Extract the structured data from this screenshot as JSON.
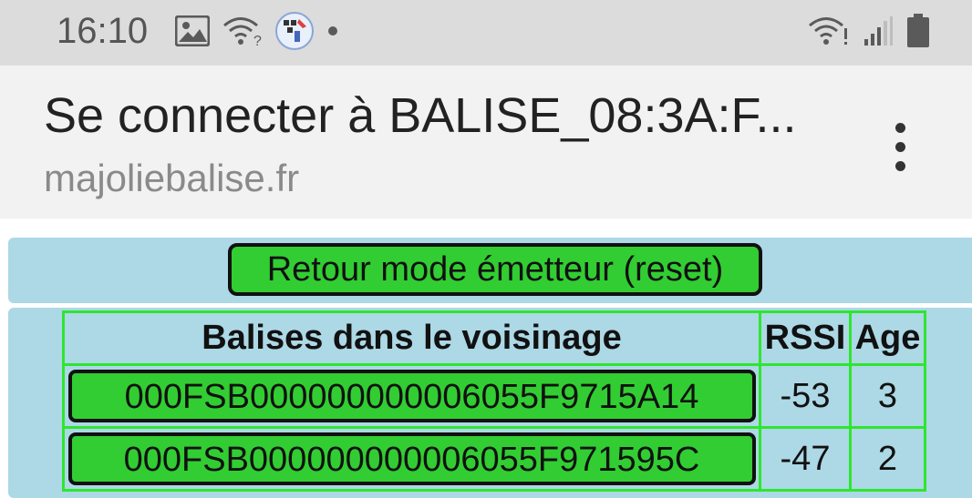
{
  "status_bar": {
    "time": "16:10",
    "left_icons": [
      "image-icon",
      "wifi-question-icon",
      "app-icon",
      "dot-icon"
    ],
    "right_icons": [
      "wifi-alert-icon",
      "signal-icon",
      "battery-icon"
    ]
  },
  "header": {
    "title": "Se connecter à BALISE_08:3A:F...",
    "domain": "majoliebalise.fr",
    "menu_icon": "more-vertical-icon"
  },
  "reset_button": {
    "label": "Retour mode émetteur (reset)"
  },
  "table": {
    "headers": [
      "Balises dans le voisinage",
      "RSSI",
      "Age"
    ],
    "rows": [
      {
        "name": "000FSB000000000006055F9715A14",
        "rssi": "-53",
        "age": "3"
      },
      {
        "name": "000FSB000000000006055F971595C",
        "rssi": "-47",
        "age": "2"
      }
    ]
  },
  "colors": {
    "status_bar_bg": "#dcdcdc",
    "header_bg": "#f2f2f2",
    "panel_bg": "#add8e6",
    "button_green": "#32cd32",
    "table_border": "#2ee62e"
  }
}
